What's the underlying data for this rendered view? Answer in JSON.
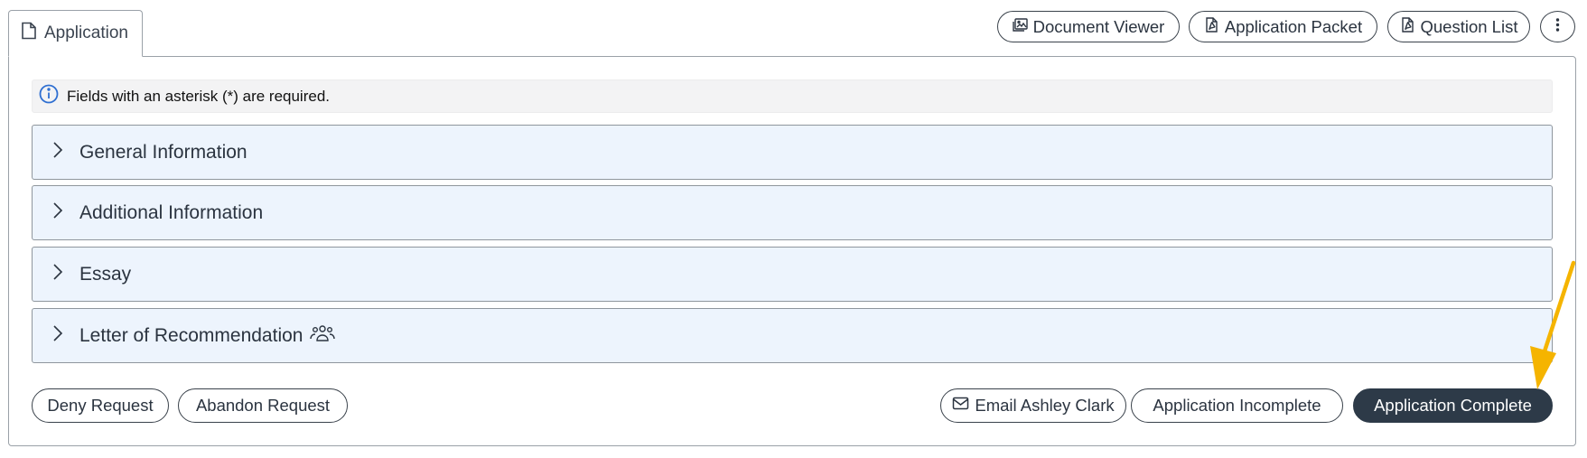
{
  "tab": {
    "label": "Application",
    "icon": "file-icon"
  },
  "toolbar": {
    "document_viewer": "Document Viewer",
    "application_packet": "Application Packet",
    "question_list": "Question List",
    "more_icon": "vertical-ellipsis-icon"
  },
  "notice": {
    "text": "Fields with an asterisk (*) are required.",
    "icon": "info-icon"
  },
  "sections": [
    {
      "label": "General Information"
    },
    {
      "label": "Additional Information"
    },
    {
      "label": "Essay"
    },
    {
      "label": "Letter of Recommendation",
      "icon": "people-group-icon"
    }
  ],
  "actions": {
    "deny": "Deny Request",
    "abandon": "Abandon Request",
    "email": "Email Ashley Clark",
    "incomplete": "Application Incomplete",
    "complete": "Application Complete"
  },
  "colors": {
    "primary_button": "#2d3a48",
    "section_background": "#edf4fd",
    "info_icon": "#2f6fd1",
    "annotation_arrow": "#f5b400"
  }
}
